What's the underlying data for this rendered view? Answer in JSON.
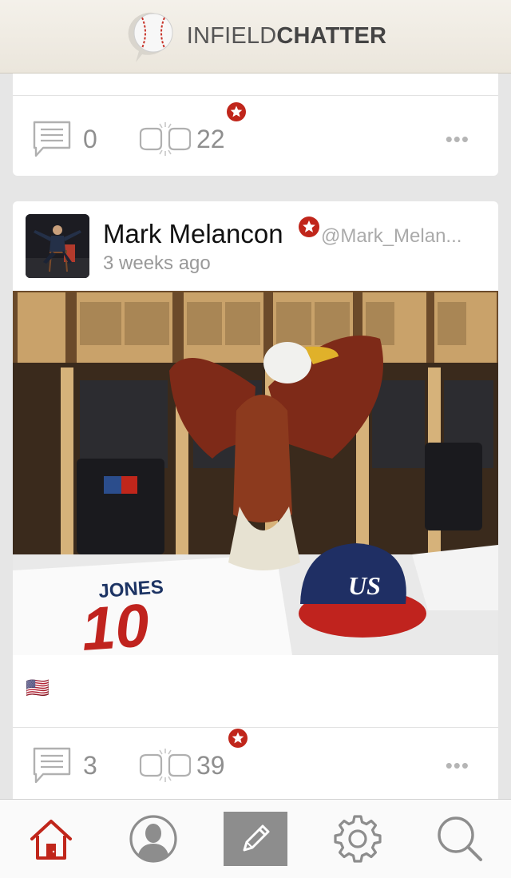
{
  "header": {
    "brand_light": "INFIELD",
    "brand_bold": "CHATTER",
    "logo_icon": "baseball-chat-icon"
  },
  "posts": [
    {
      "comments": "0",
      "claps": "22"
    },
    {
      "author": "Mark Melancon",
      "handle": "@Mark_Melan...",
      "time": "3 weeks ago",
      "caption": "🇺🇸",
      "comments": "3",
      "claps": "39"
    }
  ],
  "photo": {
    "jersey_name": "JONES",
    "jersey_number": "10"
  },
  "icons": {
    "comment": "comment-icon",
    "clap": "fist-bump-icon",
    "badge": "star-badge-icon",
    "more": "more-dots-icon"
  },
  "tabs": [
    {
      "name": "home",
      "icon": "home-icon",
      "active": true
    },
    {
      "name": "profile",
      "icon": "profile-icon",
      "active": false
    },
    {
      "name": "compose",
      "icon": "pencil-icon",
      "active": false
    },
    {
      "name": "settings",
      "icon": "gear-icon",
      "active": false
    },
    {
      "name": "search",
      "icon": "search-icon",
      "active": false
    }
  ],
  "colors": {
    "accent": "#c0261b",
    "badge": "#c0261b",
    "muted": "#8f8f8f",
    "tab_icon": "#8d8d8d"
  }
}
